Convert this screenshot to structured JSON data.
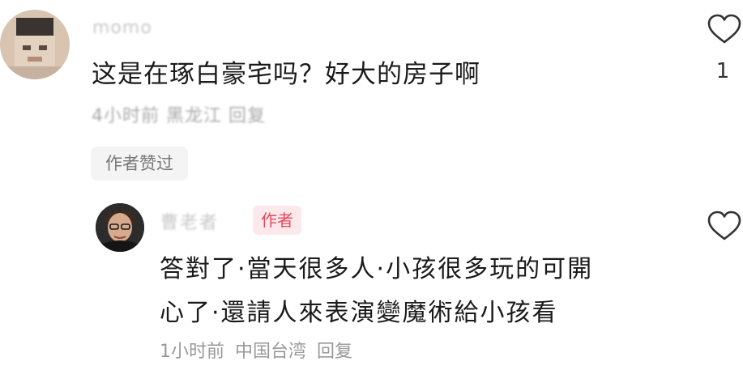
{
  "comment": {
    "username": "momo",
    "text": "这是在琢白豪宅吗？好大的房子啊",
    "meta_time": "4小时前",
    "meta_location": "黑龙江",
    "meta_reply": "回复",
    "like_count": "1",
    "author_liked": "作者赞过"
  },
  "reply": {
    "username": "曹老者",
    "author_badge": "作者",
    "text_line1": "答對了·當天很多人·小孩很多玩的可開",
    "text_line2": "心了·還請人來表演變魔術給小孩看",
    "meta_time": "1小时前",
    "meta_location": "中国台湾",
    "meta_reply": "回复"
  },
  "icons": {
    "like": "heart-outline-icon"
  },
  "colors": {
    "author_badge_text": "#e8465b",
    "author_badge_bg": "#fde9ec",
    "meta_text": "#999999"
  }
}
